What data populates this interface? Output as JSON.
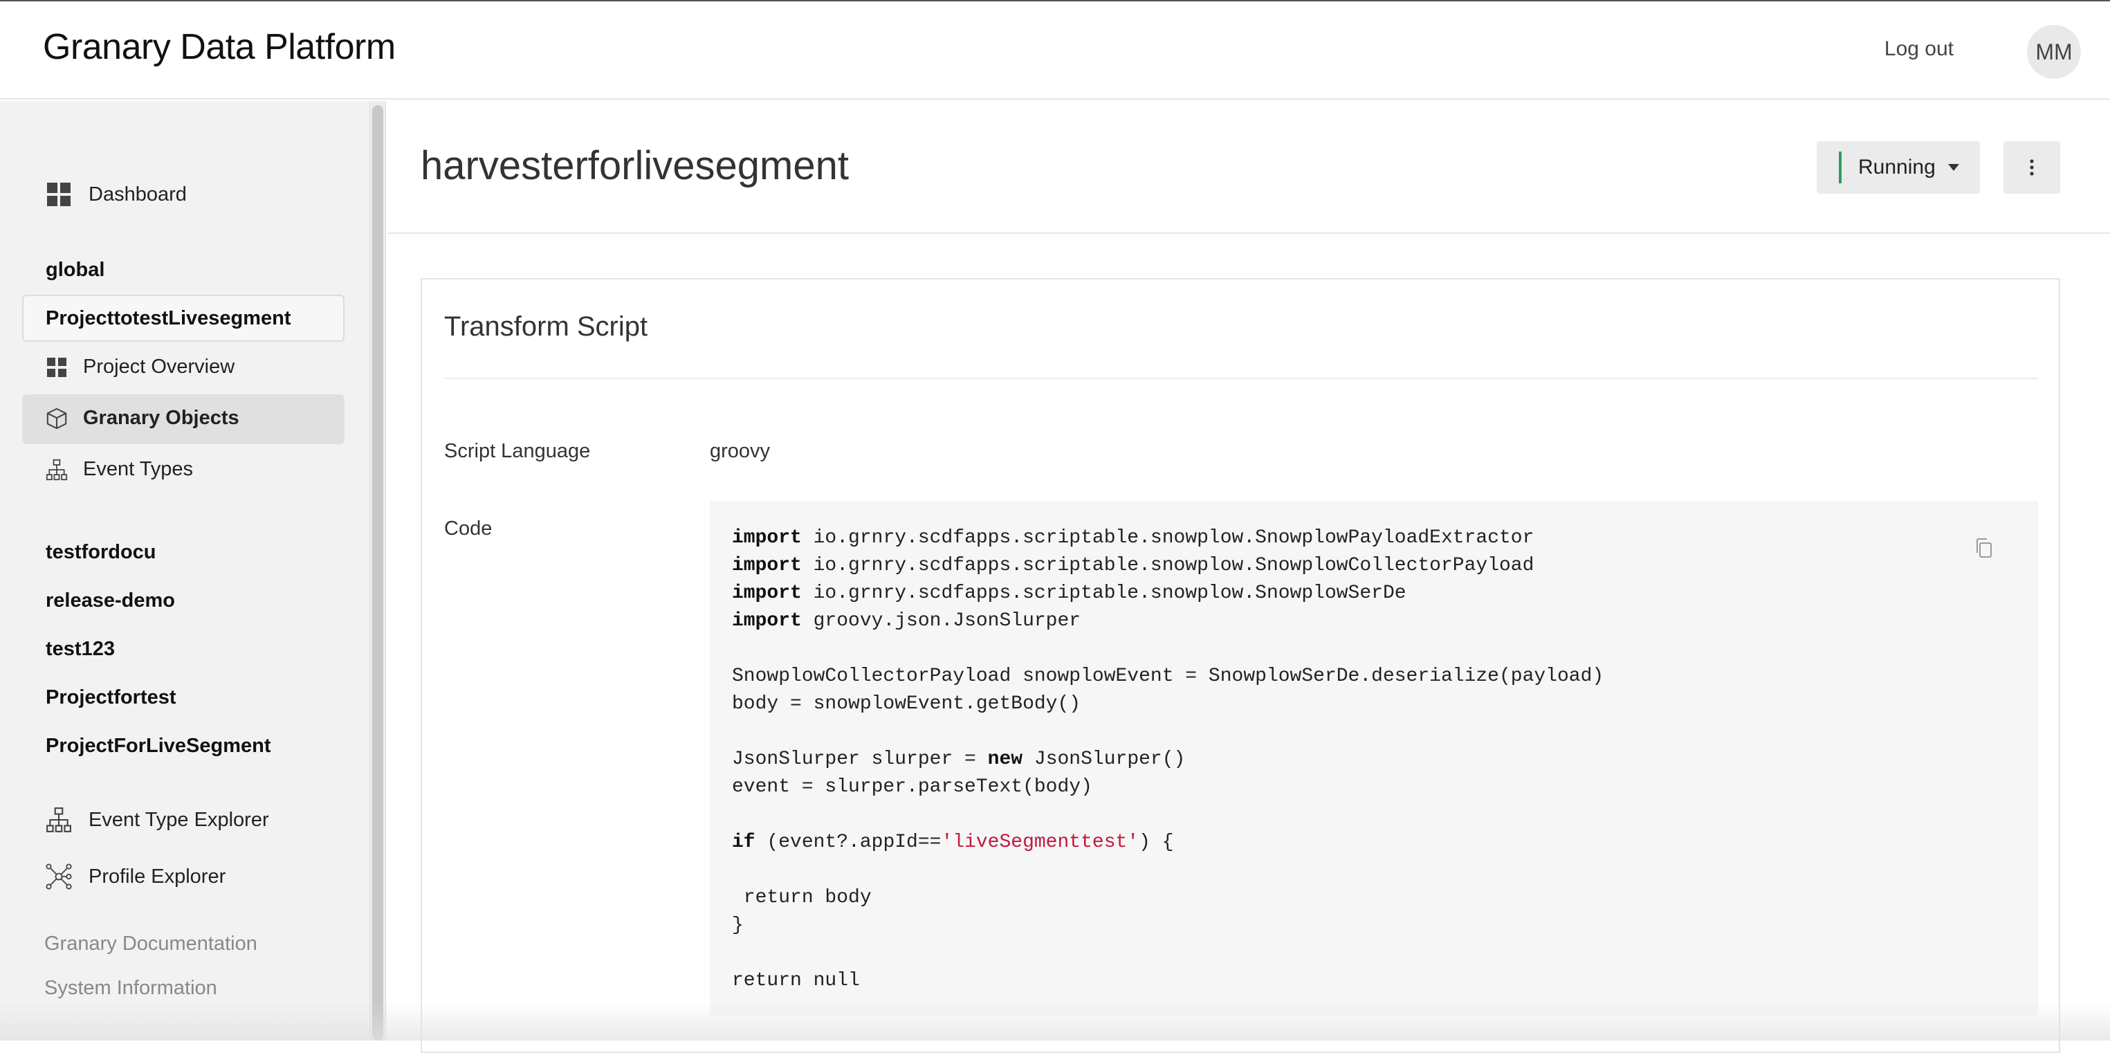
{
  "header": {
    "app_title": "Granary Data Platform",
    "logout_label": "Log out",
    "avatar_initials": "MM"
  },
  "sidebar": {
    "dashboard_label": "Dashboard",
    "global_label": "global",
    "current_project": "ProjecttotestLivesegment",
    "project_items": [
      {
        "label": "Project Overview",
        "icon": "grid-icon"
      },
      {
        "label": "Granary Objects",
        "icon": "cube-icon",
        "active": true
      },
      {
        "label": "Event Types",
        "icon": "hierarchy-icon"
      }
    ],
    "projects": [
      "testfordocu",
      "release-demo",
      "test123",
      "Projectfortest",
      "ProjectForLiveSegment"
    ],
    "explorers": [
      {
        "label": "Event Type Explorer",
        "icon": "hierarchy-icon"
      },
      {
        "label": "Profile Explorer",
        "icon": "network-icon"
      }
    ],
    "footer_links": [
      "Granary Documentation",
      "System Information"
    ]
  },
  "page": {
    "title": "harvesterforlivesegment",
    "status_label": "Running",
    "status_color": "#2e9d5a"
  },
  "card": {
    "title": "Transform Script",
    "script_language_label": "Script Language",
    "script_language_value": "groovy",
    "code_label": "Code",
    "code_lines": [
      "import io.grnry.scdfapps.scriptable.snowplow.SnowplowPayloadExtractor",
      "import io.grnry.scdfapps.scriptable.snowplow.SnowplowCollectorPayload",
      "import io.grnry.scdfapps.scriptable.snowplow.SnowplowSerDe",
      "import groovy.json.JsonSlurper",
      "",
      "SnowplowCollectorPayload snowplowEvent = SnowplowSerDe.deserialize(payload)",
      "body = snowplowEvent.getBody()",
      "",
      "JsonSlurper slurper = new JsonSlurper()",
      "event = slurper.parseText(body)",
      "",
      "if (event?.appId=='liveSegmenttest') {",
      "",
      " return body",
      "}",
      "",
      "return null"
    ]
  }
}
